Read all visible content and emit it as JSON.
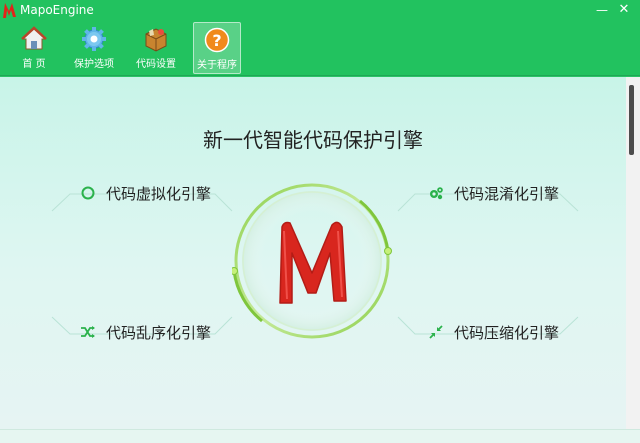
{
  "window": {
    "title": "MapoEngine",
    "minimize_label": "—",
    "close_label": "✕",
    "logo_icon": "mapo-m-logo-icon"
  },
  "toolbar": {
    "items": [
      {
        "label": "首 页",
        "icon": "home-icon"
      },
      {
        "label": "保护选项",
        "icon": "gear-icon"
      },
      {
        "label": "代码设置",
        "icon": "package-icon"
      },
      {
        "label": "关于程序",
        "icon": "help-icon"
      }
    ],
    "active_index": 3
  },
  "main": {
    "heading": "新一代智能代码保护引擎",
    "features": [
      {
        "label": "代码虚拟化引擎",
        "icon": "circle-icon"
      },
      {
        "label": "代码混淆化引擎",
        "icon": "gears-icon"
      },
      {
        "label": "代码乱序化引擎",
        "icon": "shuffle-icon"
      },
      {
        "label": "代码压缩化引擎",
        "icon": "compress-icon"
      }
    ],
    "center_logo": "M"
  },
  "colors": {
    "brand_green": "#22c25f",
    "accent_red": "#d8261e",
    "ring_green": "#8fd14f",
    "text": "#222222"
  }
}
